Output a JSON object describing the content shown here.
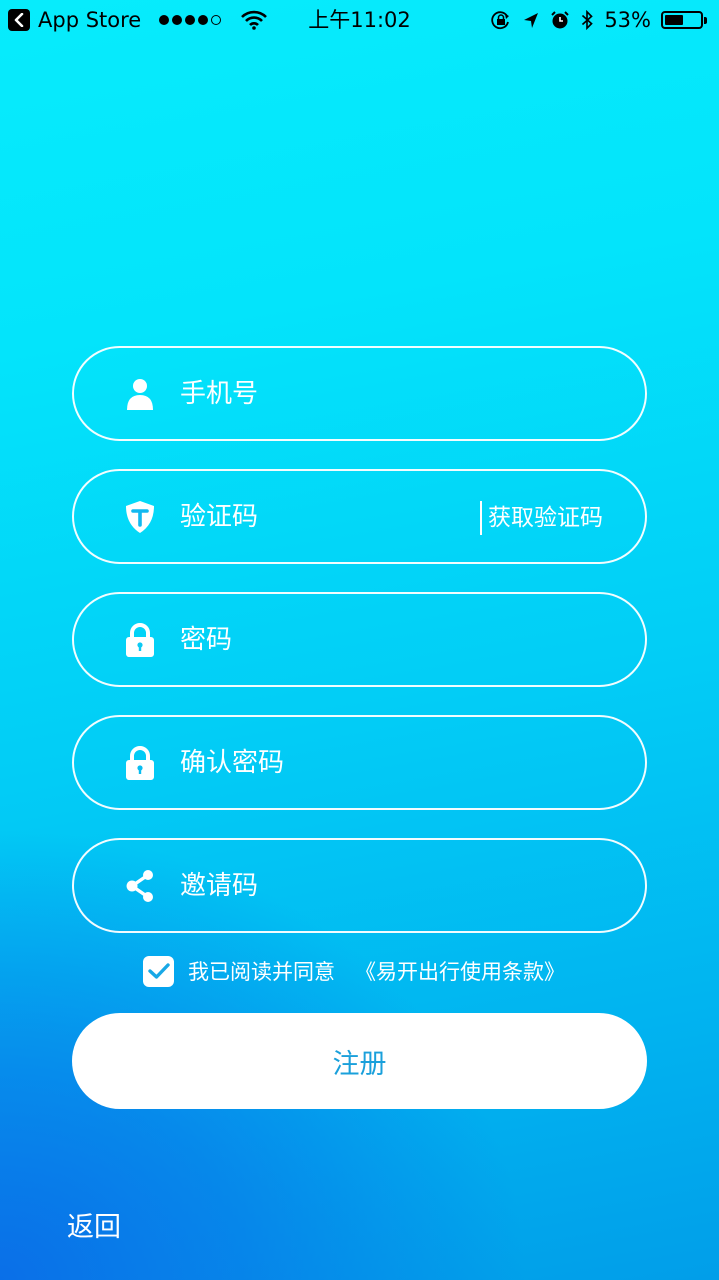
{
  "status_bar": {
    "back_app": "App Store",
    "signal_bars": 4,
    "signal_total": 5,
    "time": "上午11:02",
    "battery_text": "53%",
    "battery_level": 0.53,
    "icons": [
      "back-arrow-icon",
      "wifi-icon",
      "rotation-lock-icon",
      "location-icon",
      "alarm-icon",
      "bluetooth-icon",
      "battery-icon"
    ]
  },
  "form": {
    "phone": {
      "placeholder": "手机号",
      "icon": "user-icon"
    },
    "verification": {
      "placeholder": "验证码",
      "icon": "shield-icon",
      "get_code_label": "获取验证码"
    },
    "password": {
      "placeholder": "密码",
      "icon": "lock-icon"
    },
    "confirm_password": {
      "placeholder": "确认密码",
      "icon": "lock-icon"
    },
    "invite_code": {
      "placeholder": "邀请码",
      "icon": "share-icon"
    }
  },
  "agreement": {
    "checked": true,
    "text": "我已阅读并同意",
    "terms_link": "《易开出行使用条款》"
  },
  "register_label": "注册",
  "back_label": "返回",
  "colors": {
    "register_text": "#1aa0db",
    "gradient_top": "#07ecfc",
    "gradient_bottom_left": "#0a6fe8"
  }
}
